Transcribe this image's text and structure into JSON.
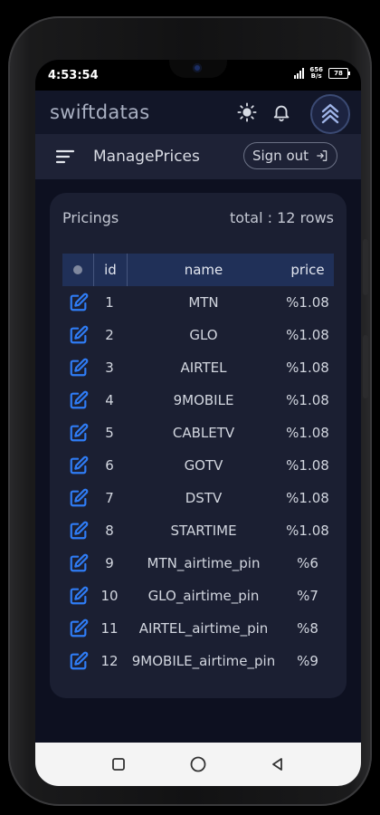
{
  "status_bar": {
    "time": "4:53:54",
    "speed_top": "656",
    "speed_bottom": "B/s",
    "battery": "78"
  },
  "app": {
    "brand": "swiftdatas"
  },
  "subheader": {
    "title": "ManagePrices",
    "signout_label": "Sign out"
  },
  "table": {
    "title": "Pricings",
    "total": "total : 12 rows",
    "columns": [
      "id",
      "name",
      "price"
    ],
    "rows": [
      {
        "id": "1",
        "name": "MTN",
        "price": "%1.08"
      },
      {
        "id": "2",
        "name": "GLO",
        "price": "%1.08"
      },
      {
        "id": "3",
        "name": "AIRTEL",
        "price": "%1.08"
      },
      {
        "id": "4",
        "name": "9MOBILE",
        "price": "%1.08"
      },
      {
        "id": "5",
        "name": "CABLETV",
        "price": "%1.08"
      },
      {
        "id": "6",
        "name": "GOTV",
        "price": "%1.08"
      },
      {
        "id": "7",
        "name": "DSTV",
        "price": "%1.08"
      },
      {
        "id": "8",
        "name": "STARTIME",
        "price": "%1.08"
      },
      {
        "id": "9",
        "name": "MTN_airtime_pin",
        "price": "%6"
      },
      {
        "id": "10",
        "name": "GLO_airtime_pin",
        "price": "%7"
      },
      {
        "id": "11",
        "name": "AIRTEL_airtime_pin",
        "price": "%8"
      },
      {
        "id": "12",
        "name": "9MOBILE_airtime_pin",
        "price": "%9"
      }
    ]
  },
  "icons": {
    "row_action": "edit-icon",
    "header": [
      "sun-icon",
      "bell-icon",
      "avatar-icon"
    ],
    "nav": [
      "recent-apps-icon",
      "home-icon",
      "back-icon"
    ]
  },
  "colors": {
    "background": "#0d1020",
    "card": "#1b1f32",
    "table_header": "#203058",
    "edit_icon": "#2f7cf5"
  }
}
